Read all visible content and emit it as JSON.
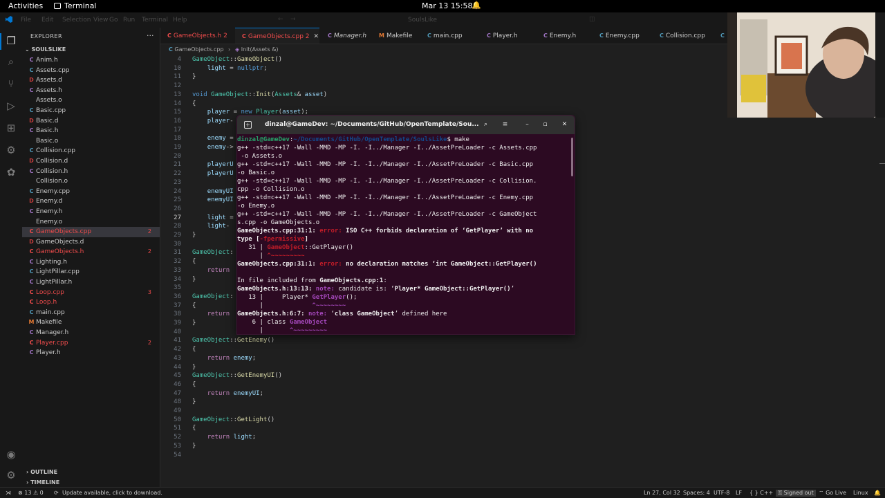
{
  "topbar": {
    "activities": "Activities",
    "app_name": "Terminal",
    "clock": "Mar 13  15:58",
    "bell_icon": "notification-bell-icon"
  },
  "menubar": {
    "items": [
      "File",
      "Edit",
      "Selection",
      "View",
      "Go",
      "Run",
      "Terminal",
      "Help"
    ],
    "search": "SoulsLike"
  },
  "sidebar": {
    "title": "EXPLORER",
    "more": "···",
    "folder": "SOULSLIKE",
    "files": [
      {
        "icon": "C",
        "name": "Anim.h",
        "color": "#a074c4",
        "badge": ""
      },
      {
        "icon": "C",
        "name": "Assets.cpp",
        "color": "#519aba",
        "badge": ""
      },
      {
        "icon": "D",
        "name": "Assets.d",
        "color": "#c03b3b",
        "badge": ""
      },
      {
        "icon": "C",
        "name": "Assets.h",
        "color": "#a074c4",
        "badge": ""
      },
      {
        "icon": "",
        "name": "Assets.o",
        "color": "#cccccc",
        "badge": ""
      },
      {
        "icon": "C",
        "name": "Basic.cpp",
        "color": "#519aba",
        "badge": ""
      },
      {
        "icon": "D",
        "name": "Basic.d",
        "color": "#c03b3b",
        "badge": ""
      },
      {
        "icon": "C",
        "name": "Basic.h",
        "color": "#a074c4",
        "badge": ""
      },
      {
        "icon": "",
        "name": "Basic.o",
        "color": "#cccccc",
        "badge": ""
      },
      {
        "icon": "C",
        "name": "Collision.cpp",
        "color": "#519aba",
        "badge": ""
      },
      {
        "icon": "D",
        "name": "Collision.d",
        "color": "#c03b3b",
        "badge": ""
      },
      {
        "icon": "C",
        "name": "Collision.h",
        "color": "#a074c4",
        "badge": ""
      },
      {
        "icon": "",
        "name": "Collision.o",
        "color": "#cccccc",
        "badge": ""
      },
      {
        "icon": "C",
        "name": "Enemy.cpp",
        "color": "#519aba",
        "badge": ""
      },
      {
        "icon": "D",
        "name": "Enemy.d",
        "color": "#c03b3b",
        "badge": ""
      },
      {
        "icon": "C",
        "name": "Enemy.h",
        "color": "#a074c4",
        "badge": ""
      },
      {
        "icon": "",
        "name": "Enemy.o",
        "color": "#cccccc",
        "badge": ""
      },
      {
        "icon": "C",
        "name": "GameObjects.cpp",
        "color": "#f14c4c",
        "badge": "2"
      },
      {
        "icon": "D",
        "name": "GameObjects.d",
        "color": "#c03b3b",
        "badge": ""
      },
      {
        "icon": "C",
        "name": "GameObjects.h",
        "color": "#f14c4c",
        "badge": "2"
      },
      {
        "icon": "C",
        "name": "Lighting.h",
        "color": "#a074c4",
        "badge": ""
      },
      {
        "icon": "C",
        "name": "LightPillar.cpp",
        "color": "#519aba",
        "badge": ""
      },
      {
        "icon": "C",
        "name": "LightPillar.h",
        "color": "#a074c4",
        "badge": ""
      },
      {
        "icon": "C",
        "name": "Loop.cpp",
        "color": "#f14c4c",
        "badge": "3"
      },
      {
        "icon": "C",
        "name": "Loop.h",
        "color": "#f14c4c",
        "badge": ""
      },
      {
        "icon": "C",
        "name": "main.cpp",
        "color": "#519aba",
        "badge": ""
      },
      {
        "icon": "M",
        "name": "Makefile",
        "color": "#e37933",
        "badge": ""
      },
      {
        "icon": "C",
        "name": "Manager.h",
        "color": "#a074c4",
        "badge": ""
      },
      {
        "icon": "C",
        "name": "Player.cpp",
        "color": "#f14c4c",
        "badge": "2"
      },
      {
        "icon": "C",
        "name": "Player.h",
        "color": "#a074c4",
        "badge": ""
      }
    ],
    "outline": "OUTLINE",
    "timeline": "TIMELINE"
  },
  "tabs": [
    {
      "icon": "C",
      "name": "GameObjects.h 2",
      "color": "#f14c4c",
      "italic": false
    },
    {
      "icon": "C",
      "name": "GameObjects.cpp 2",
      "color": "#f14c4c",
      "italic": false
    },
    {
      "icon": "C",
      "name": "Manager.h",
      "color": "#a074c4",
      "italic": true
    },
    {
      "icon": "M",
      "name": "Makefile",
      "color": "#e37933",
      "italic": false
    },
    {
      "icon": "C",
      "name": "main.cpp",
      "color": "#519aba",
      "italic": false
    },
    {
      "icon": "C",
      "name": "Player.h",
      "color": "#a074c4",
      "italic": false
    },
    {
      "icon": "C",
      "name": "Enemy.h",
      "color": "#a074c4",
      "italic": false
    },
    {
      "icon": "C",
      "name": "Enemy.cpp",
      "color": "#519aba",
      "italic": false
    },
    {
      "icon": "C",
      "name": "Collision.cpp",
      "color": "#519aba",
      "italic": false
    },
    {
      "icon": "C",
      "name": "",
      "color": "#519aba",
      "italic": false
    }
  ],
  "breadcrumb": {
    "file": "GameObjects.cpp",
    "symbol": "Init(Assets &)"
  },
  "editor": {
    "lines": [
      {
        "n": "4",
        "html": "<span class='t'>GameObject</span>::<span class='f'>GameObject</span>()"
      },
      {
        "n": "10",
        "html": "    <span class='v'>light</span> = <span class='k'>nullptr</span>;"
      },
      {
        "n": "11",
        "html": "}"
      },
      {
        "n": "12",
        "html": ""
      },
      {
        "n": "13",
        "html": "<span class='k'>void</span> <span class='t'>GameObject</span>::<span class='f'>Init</span>(<span class='t'>Assets</span>&amp; <span class='v'>asset</span>)"
      },
      {
        "n": "14",
        "html": "{"
      },
      {
        "n": "15",
        "html": "    <span class='v'>player</span> = <span class='k'>new</span> <span class='t'>Player</span>(<span class='v'>asset</span>);"
      },
      {
        "n": "16",
        "html": "    <span class='v'>player</span>-"
      },
      {
        "n": "17",
        "html": ""
      },
      {
        "n": "18",
        "html": "    <span class='v'>enemy</span> ="
      },
      {
        "n": "19",
        "html": "    <span class='v'>enemy</span>-&gt;"
      },
      {
        "n": "20",
        "html": ""
      },
      {
        "n": "21",
        "html": "    <span class='v'>playerU</span>"
      },
      {
        "n": "22",
        "html": "    <span class='v'>playerU</span>"
      },
      {
        "n": "23",
        "html": ""
      },
      {
        "n": "24",
        "html": "    <span class='v'>enemyUI</span>"
      },
      {
        "n": "25",
        "html": "    <span class='v'>enemyUI</span>"
      },
      {
        "n": "26",
        "html": ""
      },
      {
        "n": "27",
        "html": "    <span class='v'>light</span> ="
      },
      {
        "n": "28",
        "html": "    <span class='v'>light</span>-"
      },
      {
        "n": "29",
        "html": "}"
      },
      {
        "n": "30",
        "html": ""
      },
      {
        "n": "31",
        "html": "<span class='t'>GameObject</span>:"
      },
      {
        "n": "32",
        "html": "{"
      },
      {
        "n": "33",
        "html": "    <span class='c'>return</span>"
      },
      {
        "n": "34",
        "html": "}"
      },
      {
        "n": "35",
        "html": ""
      },
      {
        "n": "36",
        "html": "<span class='t'>GameObject</span>:"
      },
      {
        "n": "37",
        "html": "{"
      },
      {
        "n": "38",
        "html": "    <span class='c'>return</span>"
      },
      {
        "n": "39",
        "html": "}"
      },
      {
        "n": "40",
        "html": ""
      },
      {
        "n": "41",
        "html": "<span class='t'>GameObject</span>::<span class='f'>GetEnemy</span>()"
      },
      {
        "n": "42",
        "html": "{"
      },
      {
        "n": "43",
        "html": "    <span class='c'>return</span> <span class='v'>enemy</span>;"
      },
      {
        "n": "44",
        "html": "}"
      },
      {
        "n": "45",
        "html": "<span class='t'>GameObject</span>::<span class='f'>GetEnemyUI</span>()"
      },
      {
        "n": "46",
        "html": "{"
      },
      {
        "n": "47",
        "html": "    <span class='c'>return</span> <span class='v'>enemyUI</span>;"
      },
      {
        "n": "48",
        "html": "}"
      },
      {
        "n": "49",
        "html": ""
      },
      {
        "n": "50",
        "html": "<span class='t'>GameObject</span>::<span class='f'>GetLight</span>()"
      },
      {
        "n": "51",
        "html": "{"
      },
      {
        "n": "52",
        "html": "    <span class='c'>return</span> <span class='v'>light</span>;"
      },
      {
        "n": "53",
        "html": "}"
      },
      {
        "n": "54",
        "html": ""
      }
    ],
    "current_line": "27"
  },
  "terminal": {
    "title": "dinzal@GameDev: ~/Documents/GitHub/OpenTemplate/Sou...",
    "lines": [
      "<span class='g bold'>dinzal@GameDev</span>:<span class='b bold'>~/Documents/GitHub/OpenTemplate/SoulsLike</span>$ make",
      "g++ -std=c++17 -Wall -MMD -MP -I. -I../Manager -I../AssetPreLoader -c Assets.cpp",
      " -o Assets.o",
      "g++ -std=c++17 -Wall -MMD -MP -I. -I../Manager -I../AssetPreLoader -c Basic.cpp ",
      "-o Basic.o",
      "g++ -std=c++17 -Wall -MMD -MP -I. -I../Manager -I../AssetPreLoader -c Collision.",
      "cpp -o Collision.o",
      "g++ -std=c++17 -Wall -MMD -MP -I. -I../Manager -I../AssetPreLoader -c Enemy.cpp ",
      "-o Enemy.o",
      "g++ -std=c++17 -Wall -MMD -MP -I. -I../Manager -I../AssetPreLoader -c GameObject",
      "s.cpp -o GameObjects.o",
      "<span class='bold'>GameObjects.cpp:31:1:</span> <span class='r bold'>error: </span><span class='bold'>ISO C++ forbids declaration of ‘GetPlayer’ with no</span>",
      "<span class='bold'>type [</span><span class='r bold'>-fpermissive</span><span class='bold'>]</span>",
      "   31 | <span class='r bold'>GameObject</span>::GetPlayer()",
      "      | <span class='r bold'>^~~~~~~~~~</span>",
      "<span class='bold'>GameObjects.cpp:31:1:</span> <span class='r bold'>error: </span><span class='bold'>no declaration matches ‘int GameObject::GetPlayer()</span>",
      "",
      "In file included from <span class='bold'>GameObjects.cpp:1</span>:",
      "<span class='bold'>GameObjects.h:13:13:</span> <span class='m bold'>note: </span>candidate is: ‘<span class='bold'>Player* GameObject::GetPlayer()</span>’",
      "   13 |     Player* <span class='m bold'>GetPlayer</span>();",
      "      |             <span class='m bold'>^~~~~~~~~</span>",
      "<span class='bold'>GameObjects.h:6:7:</span> <span class='m bold'>note: </span>‘<span class='bold'>class GameObject</span>’ defined here",
      "    6 | class <span class='m bold'>GameObject</span>",
      "      |       <span class='m bold'>^~~~~~~~~~</span>"
    ]
  },
  "statusbar": {
    "problems": "⊗ 13 ⚠ 0",
    "update": "Update available, click to download.",
    "position": "Ln 27, Col 32",
    "spaces": "Spaces: 4",
    "encoding": "UTF-8",
    "eol": "LF",
    "lang": "{ } C++",
    "signed": "Signed out",
    "golive": "Go Live",
    "os": "Linux"
  },
  "colors": {
    "accent": "#0078d4",
    "terminal_bg": "#2c0a22",
    "error": "#f14c4c"
  }
}
